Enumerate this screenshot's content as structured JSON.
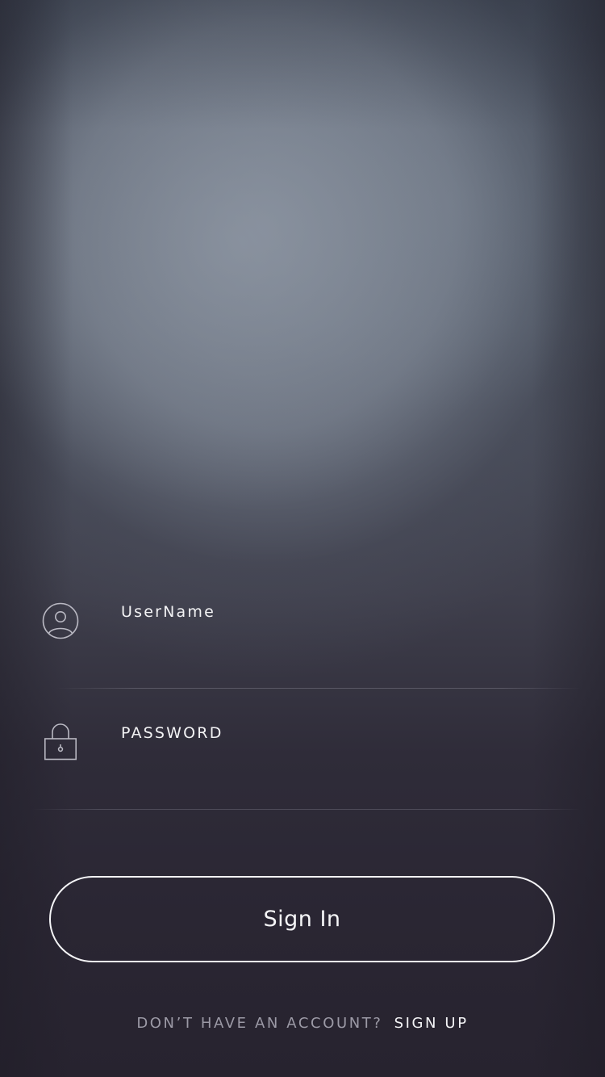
{
  "form": {
    "username": {
      "placeholder": "UserName",
      "icon": "user-icon"
    },
    "password": {
      "placeholder": "PASSWORD",
      "icon": "lock-icon"
    },
    "signin_label": "Sign In"
  },
  "footer": {
    "question": "DON’T HAVE AN ACCOUNT?",
    "link": "SIGN UP"
  },
  "colors": {
    "text_primary": "#f4f4f6",
    "text_muted": "#9c9aa6",
    "background_bottom": "#26222e"
  }
}
